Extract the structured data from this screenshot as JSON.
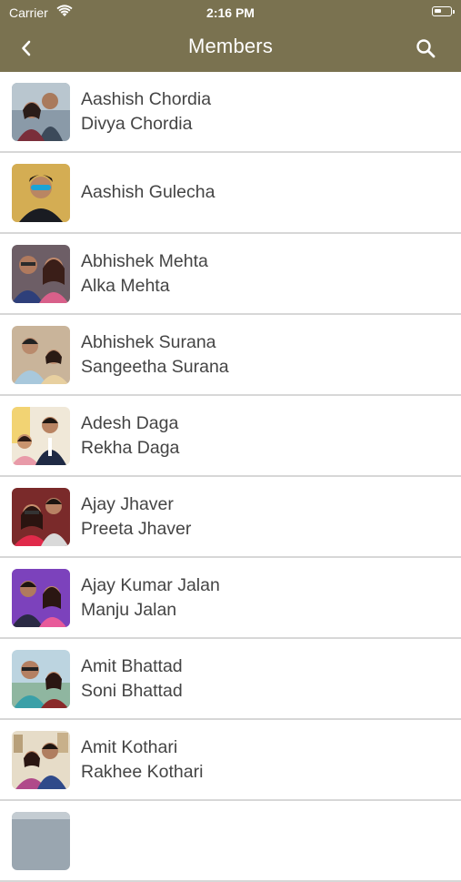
{
  "status_bar": {
    "carrier": "Carrier",
    "time": "2:16 PM"
  },
  "nav": {
    "title": "Members",
    "back_icon": "chevron-left-icon",
    "search_icon": "search-icon"
  },
  "colors": {
    "header": "#7a7250",
    "separator": "#d7d7d7",
    "text": "#444444"
  },
  "members": [
    {
      "line1": "Aashish Chordia",
      "line2": "Divya Chordia"
    },
    {
      "line1": "Aashish Gulecha",
      "line2": ""
    },
    {
      "line1": "Abhishek Mehta",
      "line2": "Alka Mehta"
    },
    {
      "line1": "Abhishek Surana",
      "line2": "Sangeetha Surana"
    },
    {
      "line1": "Adesh Daga",
      "line2": "Rekha Daga"
    },
    {
      "line1": "Ajay Jhaver",
      "line2": "Preeta Jhaver"
    },
    {
      "line1": "Ajay Kumar Jalan",
      "line2": "Manju Jalan"
    },
    {
      "line1": "Amit Bhattad",
      "line2": "Soni Bhattad"
    },
    {
      "line1": "Amit Kothari",
      "line2": "Rakhee Kothari"
    },
    {
      "line1": "",
      "line2": ""
    }
  ]
}
